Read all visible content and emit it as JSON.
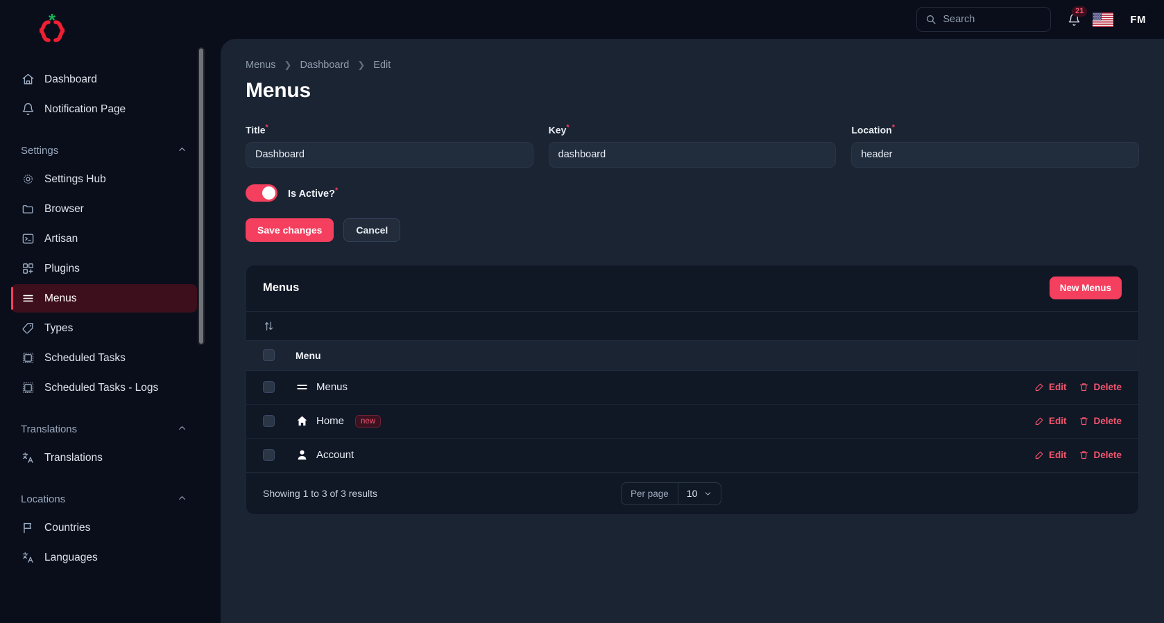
{
  "brand": {
    "logo_name": "curly-braces-asterisk-logo",
    "brace_color": "#f01f34",
    "asterisk_color": "#19b35c"
  },
  "topbar": {
    "search": {
      "placeholder": "Search",
      "icon": "search-icon"
    },
    "notifications": {
      "icon": "bell-icon",
      "count": "21"
    },
    "language_flag": "us-flag-icon",
    "avatar_initials": "FM"
  },
  "sidebar": {
    "top_items": [
      {
        "label": "Dashboard",
        "icon": "home-icon"
      },
      {
        "label": "Notification Page",
        "icon": "bell-icon"
      }
    ],
    "groups": [
      {
        "label": "Settings",
        "collapse_icon": "chevron-up-icon",
        "items": [
          {
            "label": "Settings Hub",
            "icon": "gear-icon",
            "active": false
          },
          {
            "label": "Browser",
            "icon": "folder-icon",
            "active": false
          },
          {
            "label": "Artisan",
            "icon": "terminal-icon",
            "active": false
          },
          {
            "label": "Plugins",
            "icon": "plugins-icon",
            "active": false
          },
          {
            "label": "Menus",
            "icon": "menu-lines-icon",
            "active": true
          },
          {
            "label": "Types",
            "icon": "tag-icon",
            "active": false
          },
          {
            "label": "Scheduled Tasks",
            "icon": "chip-icon",
            "active": false
          },
          {
            "label": "Scheduled Tasks - Logs",
            "icon": "chip-icon",
            "active": false
          }
        ]
      },
      {
        "label": "Translations",
        "collapse_icon": "chevron-up-icon",
        "items": [
          {
            "label": "Translations",
            "icon": "translate-icon",
            "active": false
          }
        ]
      },
      {
        "label": "Locations",
        "collapse_icon": "chevron-up-icon",
        "items": [
          {
            "label": "Countries",
            "icon": "flag-icon",
            "active": false
          },
          {
            "label": "Languages",
            "icon": "translate-icon",
            "active": false
          }
        ]
      }
    ]
  },
  "main": {
    "breadcrumb": [
      "Menus",
      "Dashboard",
      "Edit"
    ],
    "page_title": "Menus",
    "form": {
      "fields": [
        {
          "label": "Title",
          "required": "*",
          "value": "Dashboard"
        },
        {
          "label": "Key",
          "required": "*",
          "value": "dashboard"
        },
        {
          "label": "Location",
          "required": "*",
          "value": "header"
        }
      ],
      "toggle": {
        "label": "Is Active?",
        "required": "*",
        "state": "on"
      },
      "save_label": "Save changes",
      "cancel_label": "Cancel"
    },
    "table": {
      "title": "Menus",
      "new_button": "New Menus",
      "sort_icon": "sort-arrows-icon",
      "column_header": "Menu",
      "rows": [
        {
          "label": "Menus",
          "icon": "menu-lines-icon",
          "badge": "",
          "edit": "Edit",
          "delete": "Delete"
        },
        {
          "label": "Home",
          "icon": "home-filled-icon",
          "badge": "new",
          "edit": "Edit",
          "delete": "Delete"
        },
        {
          "label": "Account",
          "icon": "user-filled-icon",
          "badge": "",
          "edit": "Edit",
          "delete": "Delete"
        }
      ],
      "footer": {
        "results_text": "Showing 1 to 3 of 3 results",
        "per_page_label": "Per page",
        "per_page_value": "10",
        "per_page_chevron": "chevron-down-icon"
      }
    }
  },
  "colors": {
    "accent": "#f43f5e",
    "active_nav_bg": "#3d0f1c",
    "page_bg": "#1b2433",
    "card_bg": "#101725",
    "sidebar_bg": "#090e1a"
  }
}
